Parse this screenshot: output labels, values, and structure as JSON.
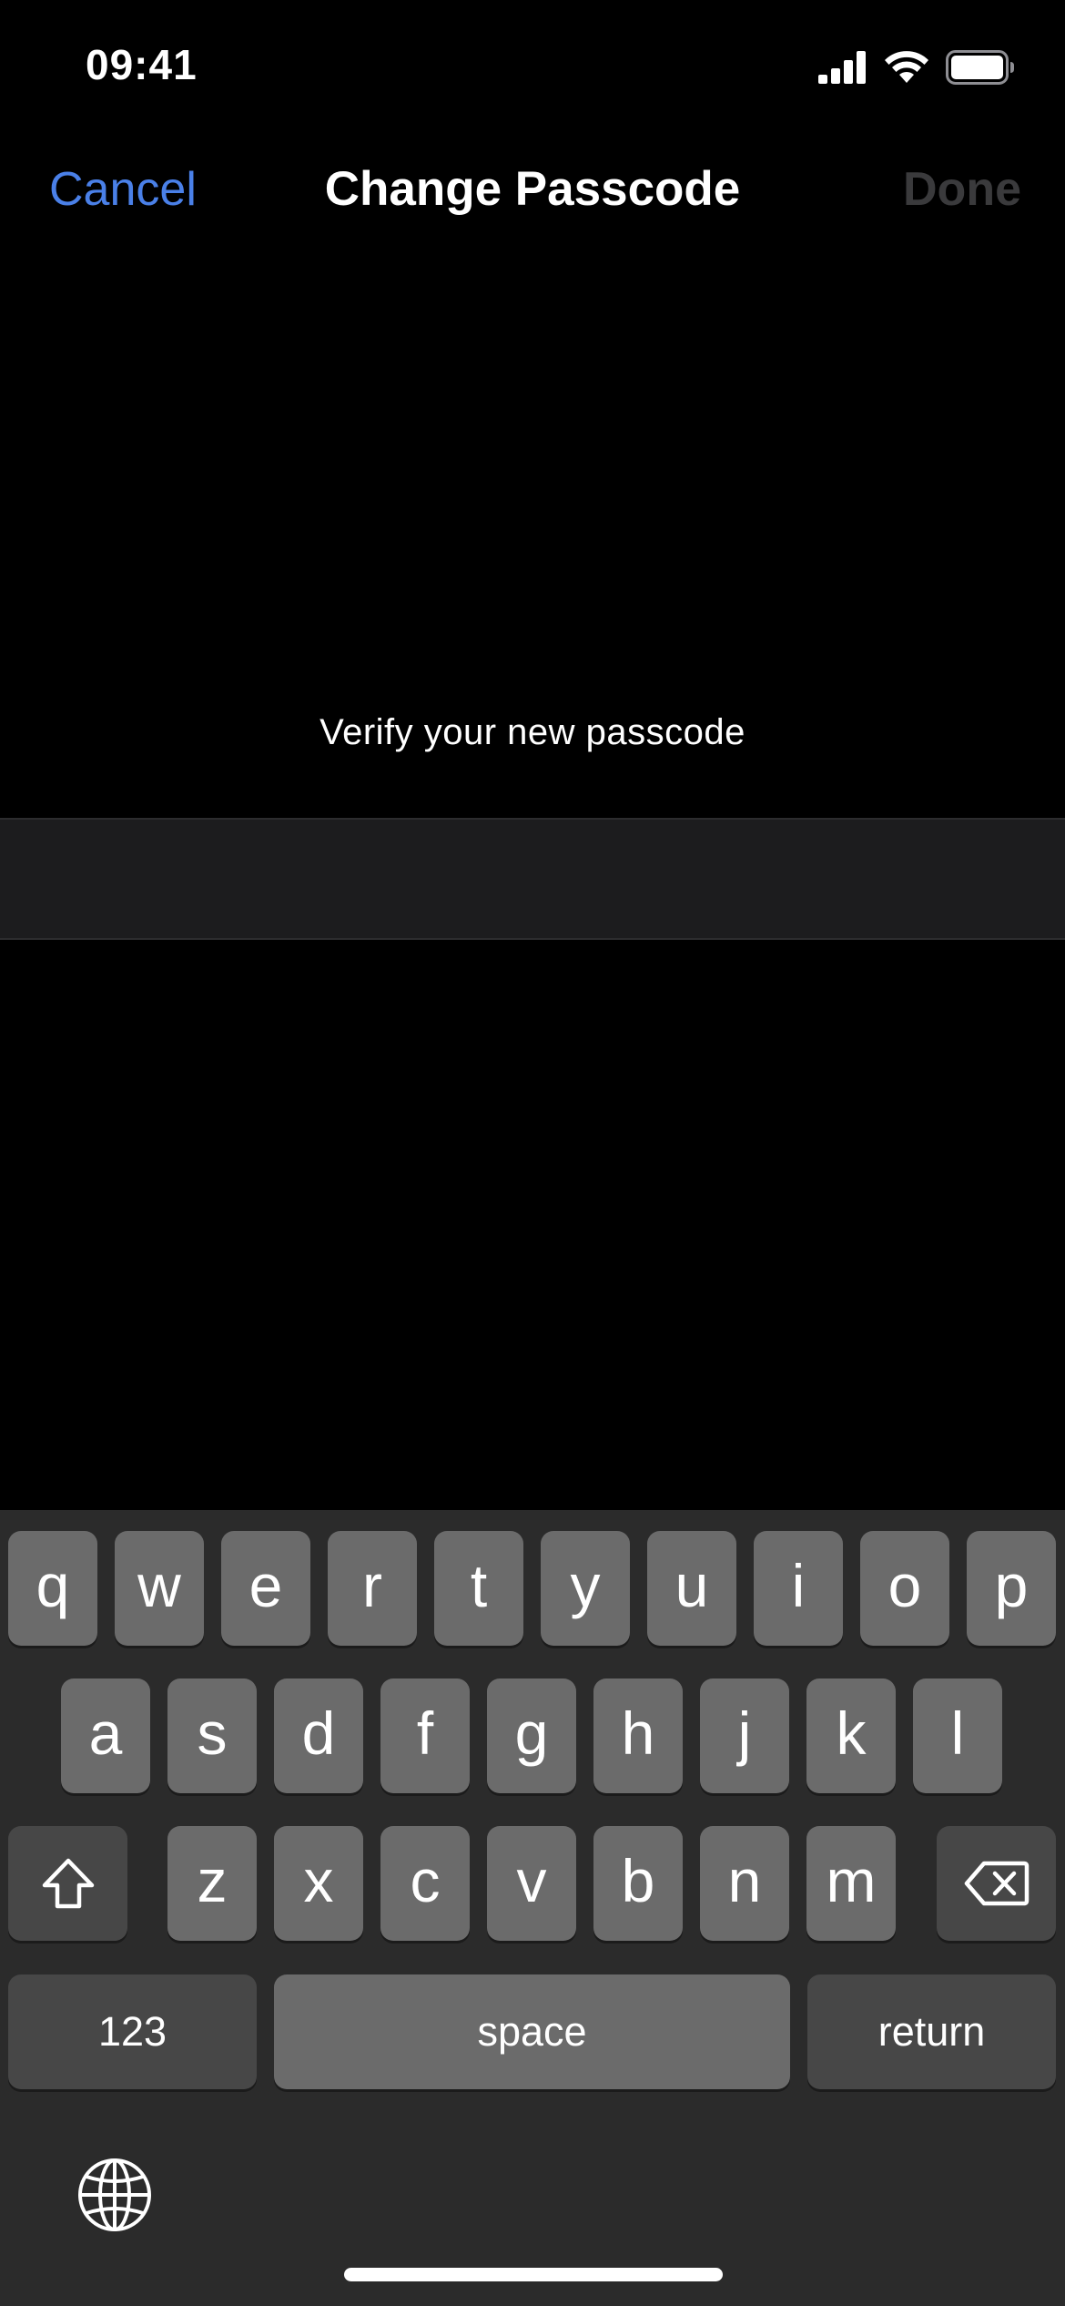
{
  "status_bar": {
    "time": "09:41"
  },
  "nav": {
    "cancel_label": "Cancel",
    "title": "Change Passcode",
    "done_label": "Done"
  },
  "prompt": "Verify your new passcode",
  "passcode_field": {
    "value": "",
    "placeholder": ""
  },
  "keyboard": {
    "row1": [
      "q",
      "w",
      "e",
      "r",
      "t",
      "y",
      "u",
      "i",
      "o",
      "p"
    ],
    "row2": [
      "a",
      "s",
      "d",
      "f",
      "g",
      "h",
      "j",
      "k",
      "l"
    ],
    "row3": [
      "z",
      "x",
      "c",
      "v",
      "b",
      "n",
      "m"
    ],
    "numbers_label": "123",
    "space_label": "space",
    "return_label": "return"
  },
  "icons": {
    "signal": "cellular-signal-icon",
    "wifi": "wifi-icon",
    "battery": "battery-icon",
    "shift": "shift-icon",
    "delete": "delete-icon",
    "globe": "globe-icon"
  },
  "colors": {
    "accent": "#4a80e8",
    "done_disabled": "#3a3a3c",
    "key": "#6b6b6b",
    "function_key": "#474747",
    "keyboard_bg": "#2b2b2b",
    "field_bg": "#1c1c1e"
  }
}
